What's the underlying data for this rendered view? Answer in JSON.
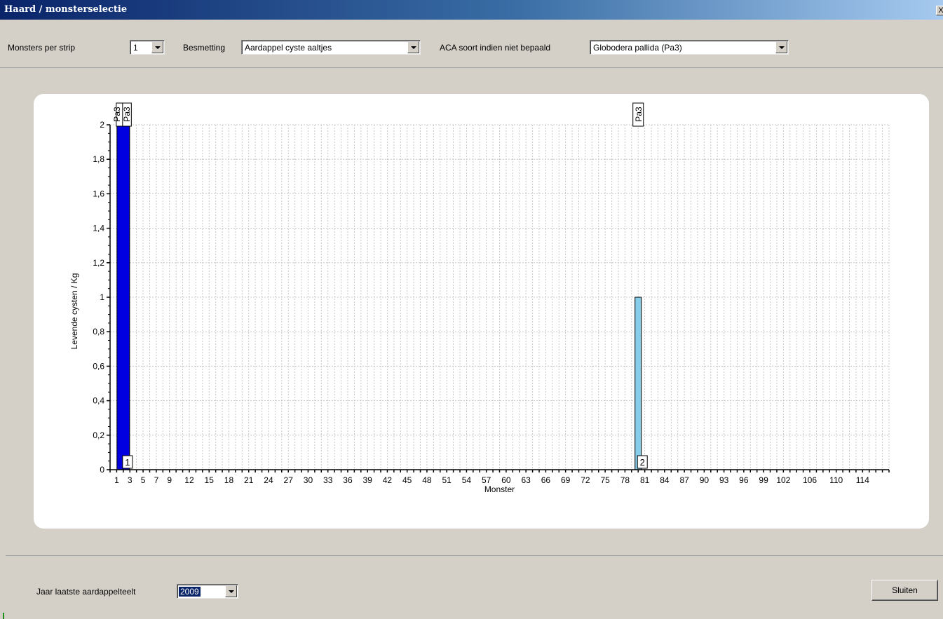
{
  "window": {
    "title": "Haard / monsterselectie",
    "close_glyph": "X"
  },
  "toolbar": {
    "monsters_label": "Monsters per strip",
    "monsters_value": "1",
    "besmetting_label": "Besmetting",
    "besmetting_value": "Aardappel cyste aaltjes",
    "aca_label": "ACA soort indien niet bepaald",
    "aca_value": "Globodera pallida (Pa3)"
  },
  "bottom": {
    "jaar_label": "Jaar laatste aardappelteelt",
    "jaar_value": "2009",
    "close_button": "Sluiten"
  },
  "colors": {
    "bar_selected": "#0000e0",
    "bar_normal": "#87ceeb"
  },
  "chart_data": {
    "type": "bar",
    "xlabel": "Monster",
    "ylabel": "Levende cysten / Kg",
    "ylim": [
      0,
      2
    ],
    "yticks": [
      "0",
      "0,2",
      "0,4",
      "0,6",
      "0,8",
      "1",
      "1,2",
      "1,4",
      "1,6",
      "1,8",
      "2"
    ],
    "xlim": [
      0,
      118
    ],
    "xticks": [
      1,
      3,
      5,
      7,
      9,
      12,
      15,
      18,
      21,
      24,
      27,
      30,
      33,
      36,
      39,
      42,
      45,
      48,
      51,
      54,
      57,
      60,
      63,
      66,
      69,
      72,
      75,
      78,
      81,
      84,
      87,
      90,
      93,
      96,
      99,
      102,
      106,
      110,
      114
    ],
    "grid": true,
    "bars": [
      {
        "x": 2,
        "value": 2,
        "label_bottom": "1",
        "label_top": "Pa3",
        "label_top_extra": "Pa3",
        "selected": true
      },
      {
        "x": 80,
        "value": 1,
        "label_bottom": "2",
        "label_top": "Pa3",
        "selected": false
      }
    ]
  }
}
